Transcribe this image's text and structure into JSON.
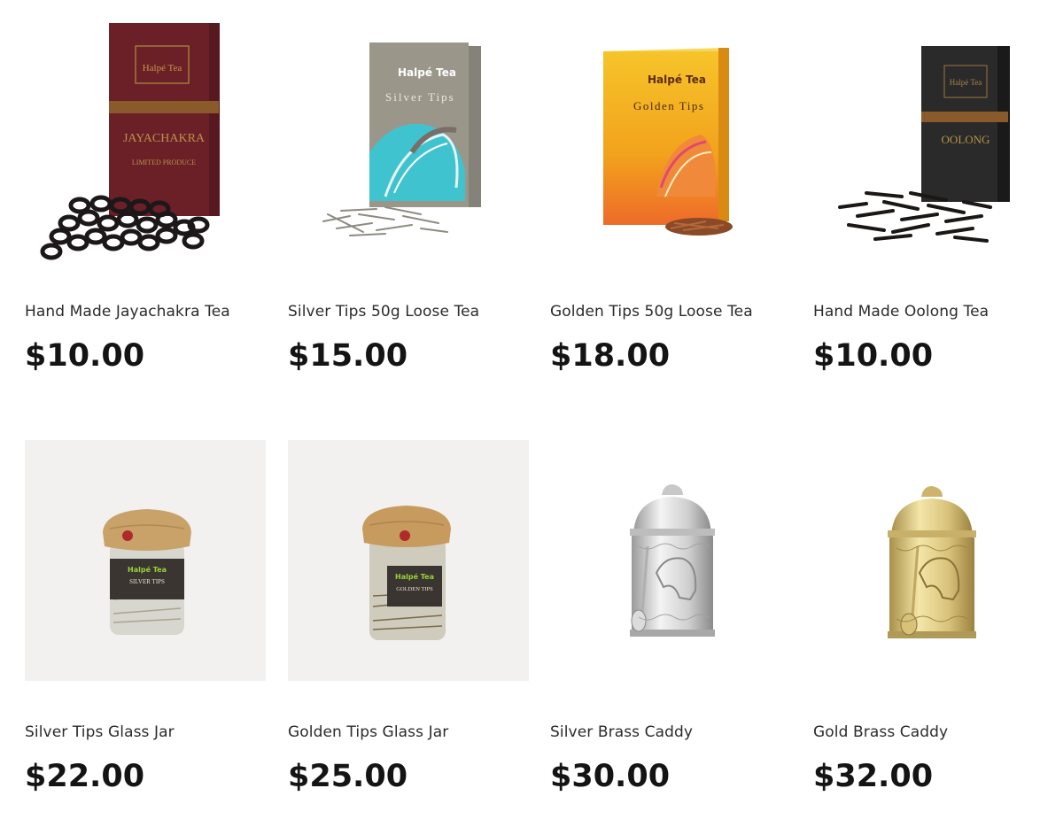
{
  "products": [
    {
      "name": "Hand Made Jayachakra Tea",
      "price": "$10.00",
      "box_brand": "Halpé Tea",
      "box_title": "JAYACHAKRA",
      "box_sub": "LIMITED PRODUCE",
      "colors": {
        "box": "#6b1f27",
        "band": "#8a5a2b"
      }
    },
    {
      "name": "Silver Tips 50g Loose Tea",
      "price": "$15.00",
      "box_brand": "Halpé Tea",
      "box_title": "Silver Tips",
      "colors": {
        "box": "#9a978a",
        "accent": "#3fc4cf"
      }
    },
    {
      "name": "Golden Tips 50g Loose Tea",
      "price": "$18.00",
      "box_brand": "Halpé Tea",
      "box_title": "Golden Tips",
      "colors": {
        "box": "#f1b21c",
        "accent": "#ee6a2a"
      }
    },
    {
      "name": "Hand Made Oolong Tea",
      "price": "$10.00",
      "box_brand": "Halpé Tea",
      "box_title": "OOLONG",
      "colors": {
        "box": "#2a2a2a",
        "band": "#8a5a2b"
      }
    },
    {
      "name": "Silver Tips Glass Jar",
      "price": "$22.00",
      "jar_brand": "Halpé Tea",
      "jar_label": "SILVER TIPS"
    },
    {
      "name": "Golden Tips Glass Jar",
      "price": "$25.00",
      "jar_brand": "Halpé Tea",
      "jar_label": "GOLDEN TIPS"
    },
    {
      "name": "Silver Brass Caddy",
      "price": "$30.00",
      "colors": {
        "metal": "#d9d9d9"
      }
    },
    {
      "name": "Gold Brass Caddy",
      "price": "$32.00",
      "colors": {
        "metal": "#d8c27a"
      }
    }
  ]
}
